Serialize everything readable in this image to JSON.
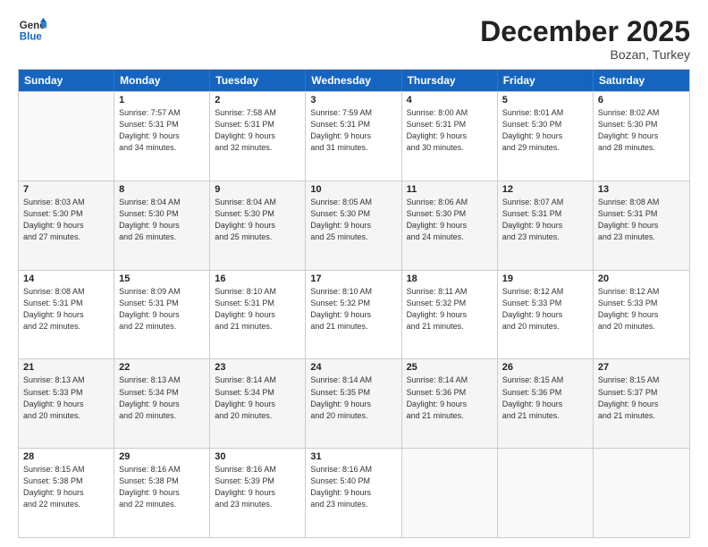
{
  "header": {
    "logo_line1": "General",
    "logo_line2": "Blue",
    "month": "December 2025",
    "location": "Bozan, Turkey"
  },
  "weekdays": [
    "Sunday",
    "Monday",
    "Tuesday",
    "Wednesday",
    "Thursday",
    "Friday",
    "Saturday"
  ],
  "rows": [
    [
      {
        "day": "",
        "lines": []
      },
      {
        "day": "1",
        "lines": [
          "Sunrise: 7:57 AM",
          "Sunset: 5:31 PM",
          "Daylight: 9 hours",
          "and 34 minutes."
        ]
      },
      {
        "day": "2",
        "lines": [
          "Sunrise: 7:58 AM",
          "Sunset: 5:31 PM",
          "Daylight: 9 hours",
          "and 32 minutes."
        ]
      },
      {
        "day": "3",
        "lines": [
          "Sunrise: 7:59 AM",
          "Sunset: 5:31 PM",
          "Daylight: 9 hours",
          "and 31 minutes."
        ]
      },
      {
        "day": "4",
        "lines": [
          "Sunrise: 8:00 AM",
          "Sunset: 5:31 PM",
          "Daylight: 9 hours",
          "and 30 minutes."
        ]
      },
      {
        "day": "5",
        "lines": [
          "Sunrise: 8:01 AM",
          "Sunset: 5:30 PM",
          "Daylight: 9 hours",
          "and 29 minutes."
        ]
      },
      {
        "day": "6",
        "lines": [
          "Sunrise: 8:02 AM",
          "Sunset: 5:30 PM",
          "Daylight: 9 hours",
          "and 28 minutes."
        ]
      }
    ],
    [
      {
        "day": "7",
        "lines": [
          "Sunrise: 8:03 AM",
          "Sunset: 5:30 PM",
          "Daylight: 9 hours",
          "and 27 minutes."
        ]
      },
      {
        "day": "8",
        "lines": [
          "Sunrise: 8:04 AM",
          "Sunset: 5:30 PM",
          "Daylight: 9 hours",
          "and 26 minutes."
        ]
      },
      {
        "day": "9",
        "lines": [
          "Sunrise: 8:04 AM",
          "Sunset: 5:30 PM",
          "Daylight: 9 hours",
          "and 25 minutes."
        ]
      },
      {
        "day": "10",
        "lines": [
          "Sunrise: 8:05 AM",
          "Sunset: 5:30 PM",
          "Daylight: 9 hours",
          "and 25 minutes."
        ]
      },
      {
        "day": "11",
        "lines": [
          "Sunrise: 8:06 AM",
          "Sunset: 5:30 PM",
          "Daylight: 9 hours",
          "and 24 minutes."
        ]
      },
      {
        "day": "12",
        "lines": [
          "Sunrise: 8:07 AM",
          "Sunset: 5:31 PM",
          "Daylight: 9 hours",
          "and 23 minutes."
        ]
      },
      {
        "day": "13",
        "lines": [
          "Sunrise: 8:08 AM",
          "Sunset: 5:31 PM",
          "Daylight: 9 hours",
          "and 23 minutes."
        ]
      }
    ],
    [
      {
        "day": "14",
        "lines": [
          "Sunrise: 8:08 AM",
          "Sunset: 5:31 PM",
          "Daylight: 9 hours",
          "and 22 minutes."
        ]
      },
      {
        "day": "15",
        "lines": [
          "Sunrise: 8:09 AM",
          "Sunset: 5:31 PM",
          "Daylight: 9 hours",
          "and 22 minutes."
        ]
      },
      {
        "day": "16",
        "lines": [
          "Sunrise: 8:10 AM",
          "Sunset: 5:31 PM",
          "Daylight: 9 hours",
          "and 21 minutes."
        ]
      },
      {
        "day": "17",
        "lines": [
          "Sunrise: 8:10 AM",
          "Sunset: 5:32 PM",
          "Daylight: 9 hours",
          "and 21 minutes."
        ]
      },
      {
        "day": "18",
        "lines": [
          "Sunrise: 8:11 AM",
          "Sunset: 5:32 PM",
          "Daylight: 9 hours",
          "and 21 minutes."
        ]
      },
      {
        "day": "19",
        "lines": [
          "Sunrise: 8:12 AM",
          "Sunset: 5:33 PM",
          "Daylight: 9 hours",
          "and 20 minutes."
        ]
      },
      {
        "day": "20",
        "lines": [
          "Sunrise: 8:12 AM",
          "Sunset: 5:33 PM",
          "Daylight: 9 hours",
          "and 20 minutes."
        ]
      }
    ],
    [
      {
        "day": "21",
        "lines": [
          "Sunrise: 8:13 AM",
          "Sunset: 5:33 PM",
          "Daylight: 9 hours",
          "and 20 minutes."
        ]
      },
      {
        "day": "22",
        "lines": [
          "Sunrise: 8:13 AM",
          "Sunset: 5:34 PM",
          "Daylight: 9 hours",
          "and 20 minutes."
        ]
      },
      {
        "day": "23",
        "lines": [
          "Sunrise: 8:14 AM",
          "Sunset: 5:34 PM",
          "Daylight: 9 hours",
          "and 20 minutes."
        ]
      },
      {
        "day": "24",
        "lines": [
          "Sunrise: 8:14 AM",
          "Sunset: 5:35 PM",
          "Daylight: 9 hours",
          "and 20 minutes."
        ]
      },
      {
        "day": "25",
        "lines": [
          "Sunrise: 8:14 AM",
          "Sunset: 5:36 PM",
          "Daylight: 9 hours",
          "and 21 minutes."
        ]
      },
      {
        "day": "26",
        "lines": [
          "Sunrise: 8:15 AM",
          "Sunset: 5:36 PM",
          "Daylight: 9 hours",
          "and 21 minutes."
        ]
      },
      {
        "day": "27",
        "lines": [
          "Sunrise: 8:15 AM",
          "Sunset: 5:37 PM",
          "Daylight: 9 hours",
          "and 21 minutes."
        ]
      }
    ],
    [
      {
        "day": "28",
        "lines": [
          "Sunrise: 8:15 AM",
          "Sunset: 5:38 PM",
          "Daylight: 9 hours",
          "and 22 minutes."
        ]
      },
      {
        "day": "29",
        "lines": [
          "Sunrise: 8:16 AM",
          "Sunset: 5:38 PM",
          "Daylight: 9 hours",
          "and 22 minutes."
        ]
      },
      {
        "day": "30",
        "lines": [
          "Sunrise: 8:16 AM",
          "Sunset: 5:39 PM",
          "Daylight: 9 hours",
          "and 23 minutes."
        ]
      },
      {
        "day": "31",
        "lines": [
          "Sunrise: 8:16 AM",
          "Sunset: 5:40 PM",
          "Daylight: 9 hours",
          "and 23 minutes."
        ]
      },
      {
        "day": "",
        "lines": []
      },
      {
        "day": "",
        "lines": []
      },
      {
        "day": "",
        "lines": []
      }
    ]
  ]
}
